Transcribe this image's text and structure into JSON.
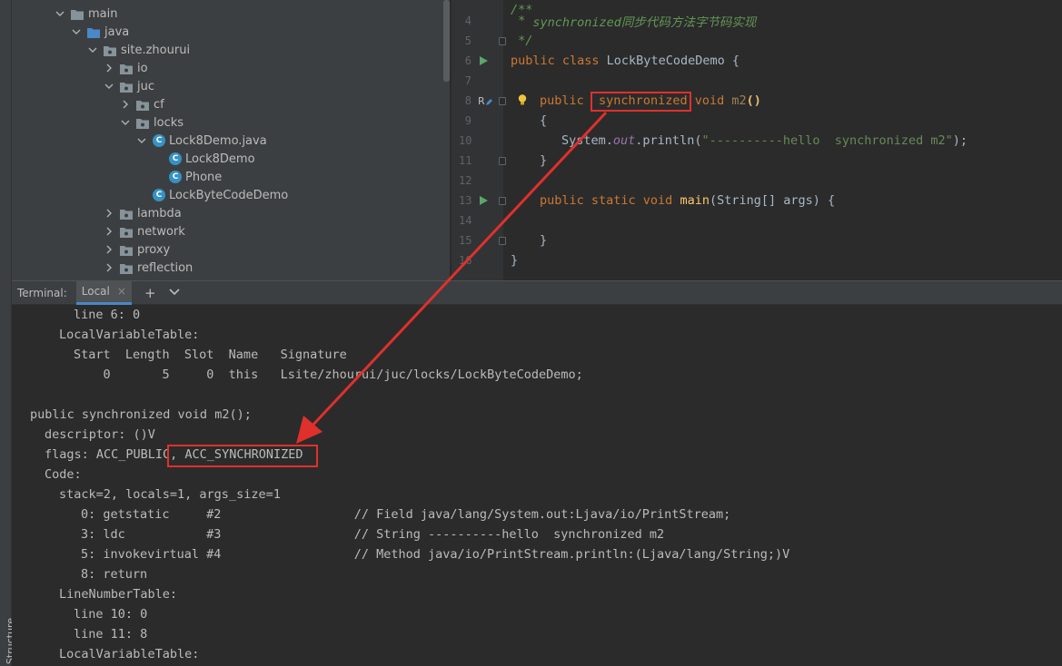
{
  "sidebar": {
    "structure_label": "Structure"
  },
  "project_tree": [
    {
      "label": "main",
      "kind": "folder",
      "expanded": true,
      "depth": 0
    },
    {
      "label": "java",
      "kind": "source-folder",
      "expanded": true,
      "depth": 1
    },
    {
      "label": "site.zhourui",
      "kind": "package",
      "expanded": true,
      "depth": 2
    },
    {
      "label": "io",
      "kind": "package",
      "expanded": false,
      "depth": 3
    },
    {
      "label": "juc",
      "kind": "package",
      "expanded": true,
      "depth": 3
    },
    {
      "label": "cf",
      "kind": "package",
      "expanded": false,
      "depth": 4
    },
    {
      "label": "locks",
      "kind": "package",
      "expanded": true,
      "depth": 4
    },
    {
      "label": "Lock8Demo.java",
      "kind": "java-file",
      "expanded": true,
      "depth": 5
    },
    {
      "label": "Lock8Demo",
      "kind": "class",
      "depth": 6
    },
    {
      "label": "Phone",
      "kind": "class",
      "depth": 6
    },
    {
      "label": "LockByteCodeDemo",
      "kind": "class",
      "depth": 5
    },
    {
      "label": "lambda",
      "kind": "package",
      "expanded": false,
      "depth": 3
    },
    {
      "label": "network",
      "kind": "package",
      "expanded": false,
      "depth": 3
    },
    {
      "label": "proxy",
      "kind": "package",
      "expanded": false,
      "depth": 3
    },
    {
      "label": "reflection",
      "kind": "package",
      "expanded": false,
      "depth": 3
    }
  ],
  "editor": {
    "line_numbers": [
      "4",
      "5",
      "6",
      "7",
      "8",
      "9",
      "10",
      "11",
      "12",
      "13",
      "14",
      "15",
      "16"
    ],
    "code": {
      "l4_star": " * ",
      "l4_text": "synchronized同步代码方法字节码实现",
      "l5": " */",
      "l6_kw": "public class ",
      "l6_name": "LockByteCodeDemo {",
      "l8_kw1": "public ",
      "l8_kw2": "synchronized",
      "l8_kw3": " void ",
      "l8_name": "m2",
      "l8_parens": "()",
      "l9": "{",
      "l10_a": "System.",
      "l10_field": "out",
      "l10_b": ".println(",
      "l10_str": "\"----------hello  synchronized m2\"",
      "l10_c": ");",
      "l11": "}",
      "l13_kw": "public static void ",
      "l13_fn": "main",
      "l13_rest": "(String[] args) {",
      "l15": "}",
      "l16": "}"
    }
  },
  "terminal": {
    "title": "Terminal:",
    "tab_label": "Local",
    "tab_close": "×",
    "add_label": "+",
    "more_label": "⌄",
    "lines": [
      "line 6: 0",
      "LocalVariableTable:",
      "Start  Length  Slot  Name   Signature",
      "    0       5     0  this   Lsite/zhourui/juc/locks/LockByteCodeDemo;",
      "",
      "public synchronized void m2();",
      "descriptor: ()V",
      "flags: ACC_PUBLIC, ACC_SYNCHRONIZED",
      "Code:",
      "stack=2, locals=1, args_size=1",
      "0: getstatic     #2                  // Field java/lang/System.out:Ljava/io/PrintStream;",
      "3: ldc           #3                  // String ----------hello  synchronized m2",
      "5: invokevirtual #4                  // Method java/io/PrintStream.println:(Ljava/lang/String;)V",
      "8: return",
      "LineNumberTable:",
      "line 10: 0",
      "line 11: 8",
      "LocalVariableTable:"
    ]
  },
  "colors": {
    "annotation": "#e0302c",
    "keyword": "#cc7832",
    "comment": "#629755",
    "string": "#6a8759",
    "tab_underline": "#4a88c7"
  }
}
